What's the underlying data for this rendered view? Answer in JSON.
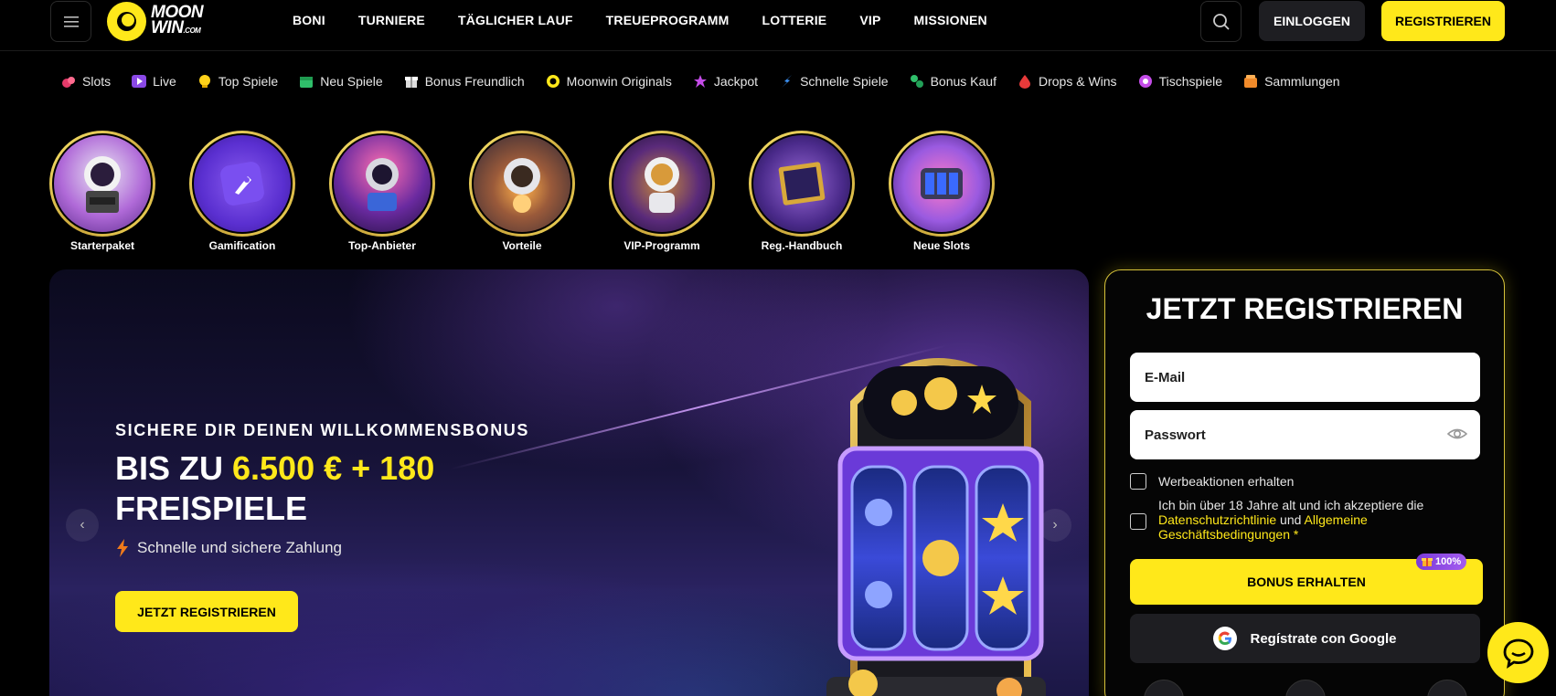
{
  "header": {
    "logo_line1": "MOON",
    "logo_line2": "WIN",
    "logo_sub": ".COM",
    "nav": [
      "BONI",
      "TURNIERE",
      "TÄGLICHER LAUF",
      "TREUEPROGRAMM",
      "LOTTERIE",
      "VIP",
      "MISSIONEN"
    ],
    "login_label": "EINLOGGEN",
    "register_label": "REGISTRIEREN"
  },
  "categories": [
    {
      "label": "Slots",
      "icon": "slots-icon"
    },
    {
      "label": "Live",
      "icon": "live-icon"
    },
    {
      "label": "Top Spiele",
      "icon": "top-games-icon"
    },
    {
      "label": "Neu Spiele",
      "icon": "new-games-icon"
    },
    {
      "label": "Bonus Freundlich",
      "icon": "bonus-friendly-icon"
    },
    {
      "label": "Moonwin Originals",
      "icon": "originals-icon"
    },
    {
      "label": "Jackpot",
      "icon": "jackpot-icon"
    },
    {
      "label": "Schnelle Spiele",
      "icon": "fast-games-icon"
    },
    {
      "label": "Bonus Kauf",
      "icon": "bonus-buy-icon"
    },
    {
      "label": "Drops & Wins",
      "icon": "drops-wins-icon"
    },
    {
      "label": "Tischspiele",
      "icon": "table-games-icon"
    },
    {
      "label": "Sammlungen",
      "icon": "collections-icon"
    }
  ],
  "stories": [
    {
      "label": "Starterpaket"
    },
    {
      "label": "Gamification"
    },
    {
      "label": "Top-Anbieter"
    },
    {
      "label": "Vorteile"
    },
    {
      "label": "VIP-Programm"
    },
    {
      "label": "Reg.-Handbuch"
    },
    {
      "label": "Neue Slots"
    }
  ],
  "hero": {
    "kicker": "SICHERE DIR DEINEN WILLKOMMENSBONUS",
    "headline_prefix": "BIS ZU ",
    "headline_highlight": "6.500 € + 180",
    "headline_line2": "FREISPIELE",
    "feature": "Schnelle und sichere Zahlung",
    "cta_label": "JETZT REGISTRIEREN"
  },
  "register_panel": {
    "title": "JETZT REGISTRIEREN",
    "email_placeholder": "E-Mail",
    "password_placeholder": "Passwort",
    "promo_checkbox": "Werbeaktionen erhalten",
    "age_text_1": "Ich bin über 18 Jahre alt und ich akzeptiere die",
    "privacy_link": "Datenschutzrichtlinie",
    "and_text": " und ",
    "terms_link": "Allgemeine Geschäftsbedingungen",
    "required_mark": " *",
    "bonus_button": "BONUS ERHALTEN",
    "bonus_badge": "100%",
    "google_button": "Regístrate con Google"
  },
  "colors": {
    "accent": "#ffe81a",
    "background": "#000000",
    "panel_border": "#d6c23a",
    "badge": "#8b48e2"
  }
}
